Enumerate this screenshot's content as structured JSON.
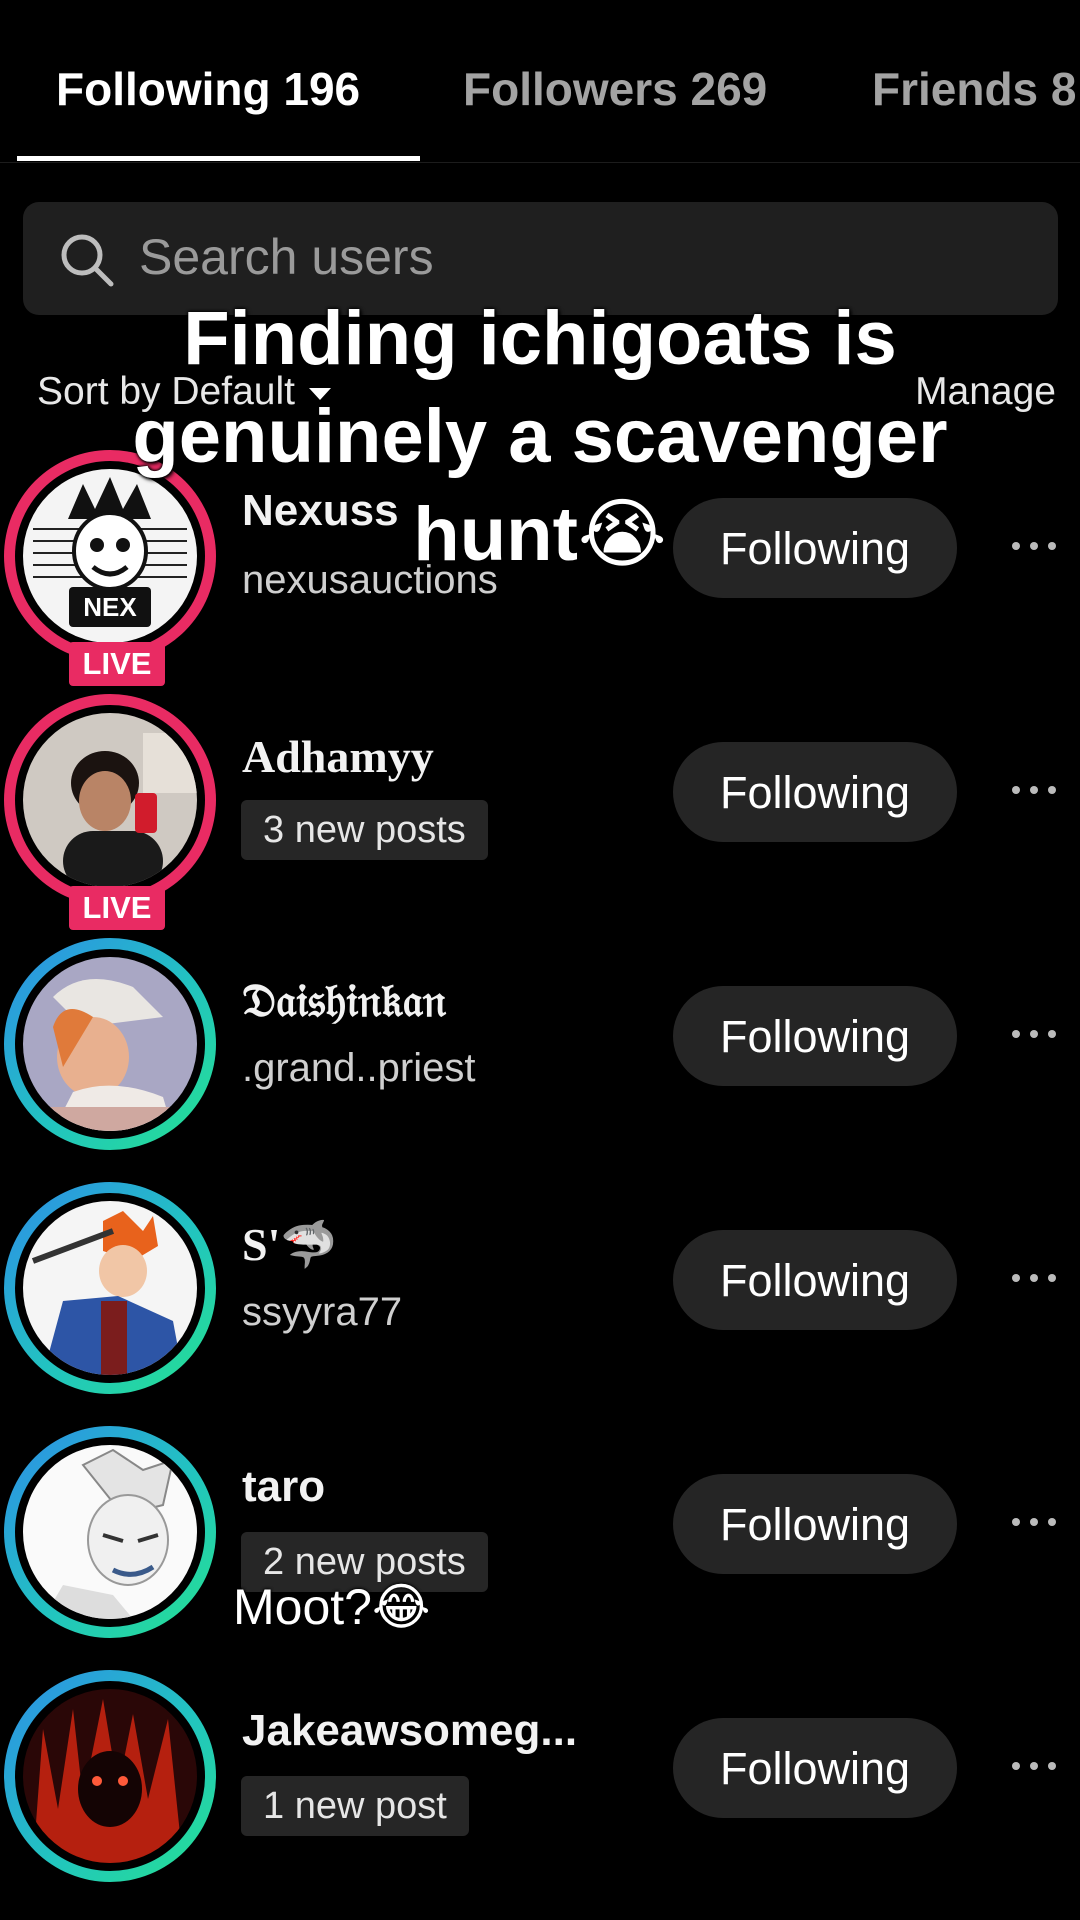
{
  "tabs": [
    {
      "label": "Following 196",
      "active": true
    },
    {
      "label": "Followers 269",
      "active": false
    },
    {
      "label": "Friends 8",
      "active": false
    }
  ],
  "search": {
    "placeholder": "Search users"
  },
  "sort": {
    "label": "Sort by Default"
  },
  "manage_label": "Manage",
  "caption": {
    "line1": "Finding ichigoats is",
    "line2": "genuinely a scavenger",
    "line3": "hunt😭"
  },
  "comment_overlay": "Moot?😂",
  "follow_button_label": "Following",
  "live_label": "LIVE",
  "users": [
    {
      "name": "Nexuss",
      "handle": "nexusauctions",
      "live": true,
      "avatar_text": "NEX"
    },
    {
      "name": "Adhamyy",
      "posts_badge": "3 new posts",
      "live": true
    },
    {
      "name": "𝔇𝔞𝔦𝔰𝔥𝔦𝔫𝔨𝔞𝔫",
      "handle": ".grand..priest",
      "live": false
    },
    {
      "name": "S'🦈",
      "handle": "ssyyra77",
      "live": false
    },
    {
      "name": "taro",
      "posts_badge": "2 new posts",
      "live": false
    },
    {
      "name": "Jakeawsomeg...",
      "posts_badge": "1 new post",
      "live": false
    }
  ],
  "colors": {
    "live_ring": "#e92b63",
    "story_ring_start": "#2d8de8",
    "story_ring_end": "#25e28f",
    "button_bg": "#252525"
  },
  "icons": {
    "search": "search-icon",
    "more": "more-horizontal-icon",
    "sort_caret": "caret-down-icon"
  }
}
